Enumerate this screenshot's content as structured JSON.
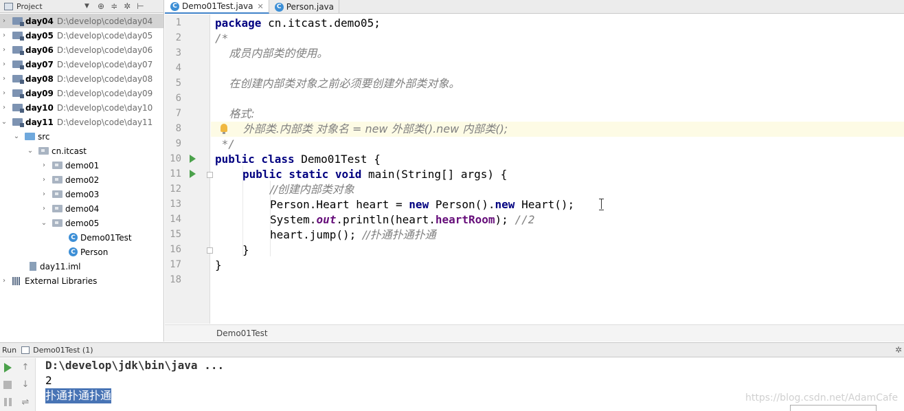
{
  "project_panel": {
    "title": "Project",
    "tree": [
      {
        "name": "day04",
        "path": "D:\\develop\\code\\day04"
      },
      {
        "name": "day05",
        "path": "D:\\develop\\code\\day05"
      },
      {
        "name": "day06",
        "path": "D:\\develop\\code\\day06"
      },
      {
        "name": "day07",
        "path": "D:\\develop\\code\\day07"
      },
      {
        "name": "day08",
        "path": "D:\\develop\\code\\day08"
      },
      {
        "name": "day09",
        "path": "D:\\develop\\code\\day09"
      },
      {
        "name": "day10",
        "path": "D:\\develop\\code\\day10"
      },
      {
        "name": "day11",
        "path": "D:\\develop\\code\\day11"
      }
    ],
    "src": "src",
    "package": "cn.itcast",
    "subpackages": [
      "demo01",
      "demo02",
      "demo03",
      "demo04",
      "demo05"
    ],
    "classes": [
      "Demo01Test",
      "Person"
    ],
    "iml": "day11.iml",
    "external": "External Libraries"
  },
  "tabs": [
    {
      "label": "Demo01Test.java",
      "icon": "class-icon"
    },
    {
      "label": "Person.java",
      "icon": "class-icon"
    }
  ],
  "editor": {
    "line_numbers": [
      "1",
      "2",
      "3",
      "4",
      "5",
      "6",
      "7",
      "8",
      "9",
      "10",
      "11",
      "12",
      "13",
      "14",
      "15",
      "16",
      "17",
      "18"
    ],
    "code": {
      "l1_kw": "package",
      "l1_rest": " cn.itcast.demo05;",
      "l2": "/*",
      "l3": "    成员内部类的使用。",
      "l5": "    在创建内部类对象之前必须要创建外部类对象。",
      "l7": "    格式:",
      "l8": "        外部类.内部类 对象名 = new 外部类().new 内部类();",
      "l9": " */",
      "l10_kw": "public class",
      "l10_rest": " Demo01Test {",
      "l11_kw": "public static void",
      "l11_rest": " main(String[] args) {",
      "l12": "//创建内部类对象",
      "l13_a": "Person.Heart heart = ",
      "l13_new1": "new",
      "l13_b": " Person().",
      "l13_new2": "new",
      "l13_c": " Heart();",
      "l14_a": "System.",
      "l14_out": "out",
      "l14_b": ".println(heart.",
      "l14_fld": "heartRoom",
      "l14_c": "); ",
      "l14_cmt": "//2",
      "l15_a": "heart.jump(); ",
      "l15_cmt": "//扑通扑通扑通",
      "l16": "}",
      "l17": "}"
    },
    "breadcrumb": "Demo01Test"
  },
  "run_panel": {
    "label": "Run",
    "tab": "Demo01Test (1)",
    "console": [
      "D:\\develop\\jdk\\bin\\java ...",
      "2",
      "扑通扑通扑通"
    ]
  },
  "watermark": "https://blog.csdn.net/AdamCafe"
}
